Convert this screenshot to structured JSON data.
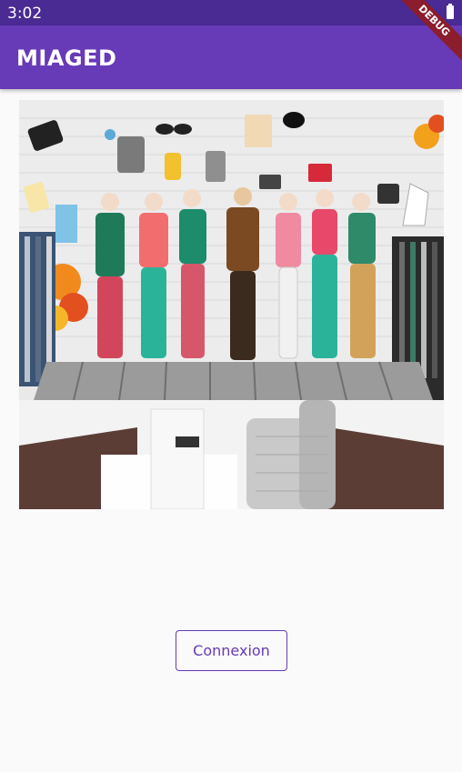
{
  "status_bar": {
    "time": "3:02",
    "battery_icon": "battery-icon"
  },
  "app_bar": {
    "title": "MIAGED"
  },
  "debug_banner": {
    "label": "DEBUG"
  },
  "hero_image": {
    "subject": "fashion-store-mural"
  },
  "login_button": {
    "label": "Connexion"
  },
  "colors": {
    "primary": "#673ab7",
    "status_bar": "#4a2a93",
    "debug": "#8b1d2c",
    "background": "#fafafa"
  }
}
